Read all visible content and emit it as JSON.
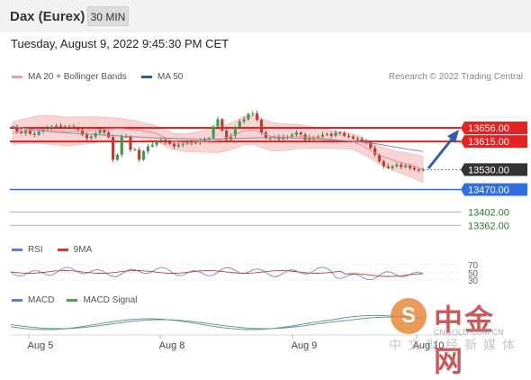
{
  "header": {
    "title": "Dax (Eurex)",
    "timeframe_button": "30 MIN"
  },
  "datetime": "Tuesday, August 9, 2022 9:45:30 PM CET",
  "legend": {
    "bollinger": "MA 20 + Bollinger Bands",
    "ma50": "MA 50"
  },
  "credit": "Research © 2022 Trading Central",
  "colors": {
    "candle_up": "#3a9e4a",
    "candle_down": "#c23b2c",
    "bollinger_fill": "#f8d4d4",
    "ma20": "#e88b8b",
    "ma50": "#8a8aa6",
    "resistance": "#e52222",
    "support": "#2f6fe0",
    "target_green": "#9ac79a",
    "arrow": "#2f5fa8",
    "price_tag": "#333333",
    "rsi": "#5b7fd6",
    "rsi_ma": "#d33b3b",
    "macd": "#5b7fd6",
    "macd_signal": "#4fa34f"
  },
  "levels": [
    {
      "value": 13656,
      "label": "13656.00",
      "kind": "resistance"
    },
    {
      "value": 13615,
      "label": "13615.00",
      "kind": "resistance"
    },
    {
      "value": 13530,
      "label": "13530.00",
      "kind": "current"
    },
    {
      "value": 13470,
      "label": "13470.00",
      "kind": "support"
    },
    {
      "value": 13402,
      "label": "13402.00",
      "kind": "target"
    },
    {
      "value": 13362,
      "label": "13362.00",
      "kind": "target"
    }
  ],
  "rsi_panel": {
    "legend_rsi": "RSI",
    "legend_ma": "9MA",
    "levels": [
      "70",
      "50",
      "30"
    ]
  },
  "macd_panel": {
    "legend_macd": "MACD",
    "legend_signal": "MACD Signal"
  },
  "xaxis": {
    "labels": [
      "Aug 5",
      "Aug 8",
      "Aug 9",
      "Aug 10"
    ]
  },
  "watermark": {
    "circle_char": "S",
    "brand_cn": "中金网",
    "url": "CNGOLD.COM.CN",
    "sub_cn": "中文财经新媒体"
  },
  "chart_data": {
    "type": "line",
    "title": "Dax (Eurex) 30 MIN",
    "x_labels": [
      "Aug 5",
      "Aug 8",
      "Aug 9",
      "Aug 10"
    ],
    "closes": [
      13660,
      13645,
      13640,
      13650,
      13638,
      13635,
      13645,
      13652,
      13655,
      13660,
      13662,
      13660,
      13658,
      13660,
      13656,
      13650,
      13635,
      13625,
      13630,
      13640,
      13650,
      13642,
      13628,
      13560,
      13575,
      13630,
      13630,
      13590,
      13590,
      13560,
      13585,
      13600,
      13605,
      13615,
      13620,
      13612,
      13608,
      13600,
      13605,
      13608,
      13612,
      13610,
      13612,
      13618,
      13620,
      13625,
      13660,
      13682,
      13648,
      13620,
      13632,
      13658,
      13676,
      13682,
      13698,
      13700,
      13680,
      13642,
      13625,
      13625,
      13630,
      13622,
      13628,
      13630,
      13635,
      13642,
      13636,
      13620,
      13628,
      13625,
      13630,
      13635,
      13638,
      13632,
      13642,
      13640,
      13632,
      13630,
      13624,
      13622,
      13618,
      13612,
      13595,
      13575,
      13555,
      13540,
      13535,
      13540,
      13545,
      13538,
      13542,
      13535,
      13530,
      13528,
      13530
    ],
    "ma20": [
      13640,
      13645,
      13648,
      13652,
      13650,
      13648,
      13645,
      13646,
      13648,
      13650,
      13652,
      13653,
      13654,
      13652,
      13650,
      13645,
      13640,
      13628,
      13615,
      13612,
      13612,
      13614,
      13616,
      13618,
      13626,
      13636,
      13648,
      13650,
      13640,
      13630,
      13628,
      13628,
      13630,
      13628,
      13626,
      13624,
      13620,
      13618,
      13616,
      13605,
      13590,
      13575,
      13565,
      13555,
      13548,
      13540,
      13530
    ],
    "ma50": [
      13660,
      13655,
      13650,
      13645,
      13642,
      13640,
      13638,
      13636,
      13634,
      13632,
      13630,
      13628,
      13626,
      13625,
      13624,
      13623,
      13622,
      13622,
      13623,
      13624,
      13625,
      13626,
      13626,
      13626,
      13625,
      13624,
      13622,
      13620,
      13618,
      13616,
      13612,
      13608,
      13602,
      13596,
      13590,
      13585
    ],
    "ylim": [
      13340,
      13720
    ]
  }
}
